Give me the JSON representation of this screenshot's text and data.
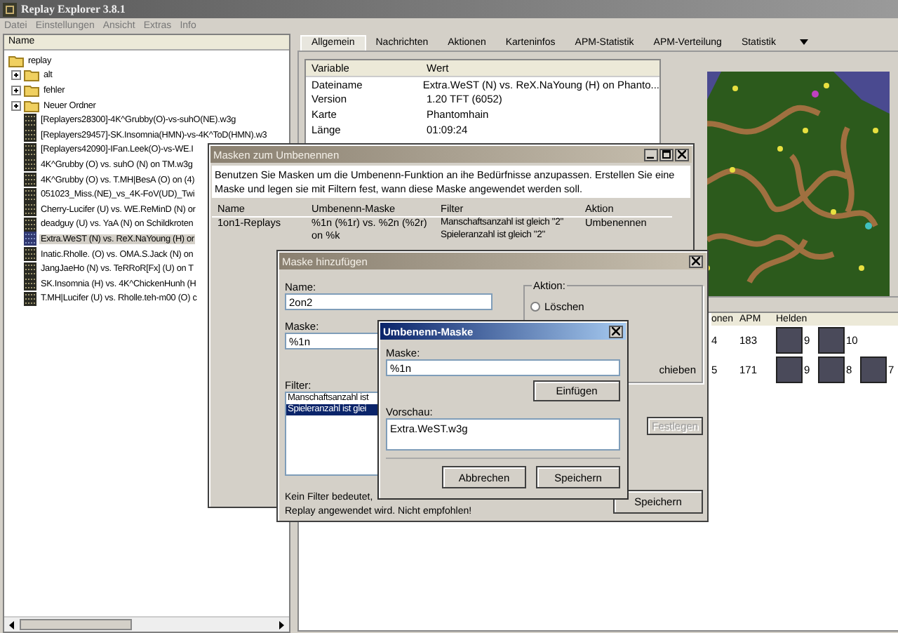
{
  "window": {
    "title": "Replay Explorer 3.8.1",
    "active": false
  },
  "menu": [
    "Datei",
    "Einstellungen",
    "Ansicht",
    "Extras",
    "Info"
  ],
  "tree": {
    "column": "Name",
    "items": [
      {
        "kind": "folder",
        "label": "replay",
        "children": [
          {
            "kind": "folder",
            "label": "alt",
            "expanded": false
          },
          {
            "kind": "folder",
            "label": "fehler",
            "expanded": false
          },
          {
            "kind": "folder",
            "label": "Neuer Ordner",
            "expanded": false
          },
          {
            "kind": "file",
            "label": "[Replayers28300]-4K^Grubby(O)-vs-suhO(NE).w3g",
            "selected": false
          },
          {
            "kind": "file",
            "label": "[Replayers29457]-SK.Insomnia(HMN)-vs-4K^ToD(HMN).w3",
            "selected": false
          },
          {
            "kind": "file",
            "label": "[Replayers42090]-IFan.Leek(O)-vs-WE.I",
            "selected": false
          },
          {
            "kind": "file",
            "label": "4K^Grubby (O) vs. suhO (N) on TM.w3g",
            "selected": false
          },
          {
            "kind": "file",
            "label": "4K^Grubby (O) vs. T.MH|BesA (O) on (4)",
            "selected": false
          },
          {
            "kind": "file",
            "label": "051023_Miss.(NE)_vs_4K-FoV(UD)_Twi",
            "selected": false
          },
          {
            "kind": "file",
            "label": "Cherry-Lucifer (U) vs. WE.ReMinD (N) or",
            "selected": false
          },
          {
            "kind": "file",
            "label": "deadguy (U) vs. YaA (N) on Schildkroten",
            "selected": false
          },
          {
            "kind": "file",
            "label": "Extra.WeST (N) vs. ReX.NaYoung (H) or",
            "selected": true
          },
          {
            "kind": "file",
            "label": "Inatic.Rholle. (O) vs. OMA.S.Jack (N) on",
            "selected": false
          },
          {
            "kind": "file",
            "label": "JangJaeHo (N) vs. TeRRoR[Fx] (U) on T",
            "selected": false
          },
          {
            "kind": "file",
            "label": "SK.Insomnia (H) vs. 4K^ChickenHunh (H",
            "selected": false
          },
          {
            "kind": "file",
            "label": "T.MH|Lucifer (U) vs. Rholle.teh-m00 (O) c",
            "selected": false
          }
        ]
      }
    ]
  },
  "tabs": [
    {
      "label": "Allgemein",
      "selected": true
    },
    {
      "label": "Nachrichten",
      "selected": false
    },
    {
      "label": "Aktionen",
      "selected": false
    },
    {
      "label": "Karteninfos",
      "selected": false
    },
    {
      "label": "APM-Statistik",
      "selected": false
    },
    {
      "label": "APM-Verteilung",
      "selected": false
    },
    {
      "label": "Statistik",
      "selected": false
    }
  ],
  "info_table": {
    "columns": [
      "Variable",
      "Wert"
    ],
    "rows": [
      [
        "Dateiname",
        "Extra.WeST (N) vs. ReX.NaYoung (H) on Phanto..."
      ],
      [
        "Version",
        "1.20 TFT (6052)"
      ],
      [
        "Karte",
        "Phantomhain"
      ],
      [
        "Länge",
        "01:09:24"
      ]
    ]
  },
  "players": {
    "columns": [
      "onen",
      "APM",
      "Helden"
    ],
    "rows": [
      {
        "cells": [
          "4",
          "183"
        ],
        "heroes": [
          "9",
          "10"
        ]
      },
      {
        "cells": [
          "5",
          "171"
        ],
        "heroes": [
          "9",
          "8",
          "7"
        ]
      }
    ]
  },
  "masks_window": {
    "title": "Masken zum Umbenennen",
    "active": false,
    "description": "Benutzen Sie Masken um die Umbenenn-Funktion an ihe Bedürfnisse anzupassen. Erstellen Sie eine Maske und legen sie mit Filtern fest, wann diese Maske angewendet werden soll.",
    "columns": [
      "Name",
      "Umbenenn-Maske",
      "Filter",
      "Aktion"
    ],
    "rows": [
      {
        "name": "1on1-Replays",
        "mask": "%1n (%1r) vs. %2n (%2r) on %k",
        "filters": [
          "Manschaftsanzahl ist gleich \"2\"",
          "Spieleranzahl ist gleich \"2\""
        ],
        "action": "Umbenennen"
      }
    ]
  },
  "add_mask_window": {
    "title": "Maske hinzufügen",
    "active": false,
    "name_label": "Name:",
    "name_value": "2on2",
    "mask_label": "Maske:",
    "mask_value": "%1n",
    "filter_label": "Filter:",
    "filters": [
      {
        "label": "Manschaftsanzahl ist",
        "selected": false
      },
      {
        "label": "Spieleranzahl ist glei",
        "selected": true
      }
    ],
    "action_label": "Aktion:",
    "options": [
      {
        "label": "Löschen",
        "checked": false
      }
    ],
    "action_tail": "chieben",
    "set_button": {
      "label": "Festlegen",
      "disabled": true
    },
    "note_lines": [
      "Kein Filter bedeutet,",
      "Replay angewendet wird. Nicht empfohlen!"
    ],
    "save_button": "Speichern"
  },
  "rename_dialog": {
    "title": "Umbenenn-Maske",
    "active": true,
    "mask_label": "Maske:",
    "mask_value": "%1n",
    "insert_button": "Einfügen",
    "preview_label": "Vorschau:",
    "preview_value": "Extra.WeST.w3g",
    "buttons": [
      "Abbrechen",
      "Speichern"
    ]
  }
}
